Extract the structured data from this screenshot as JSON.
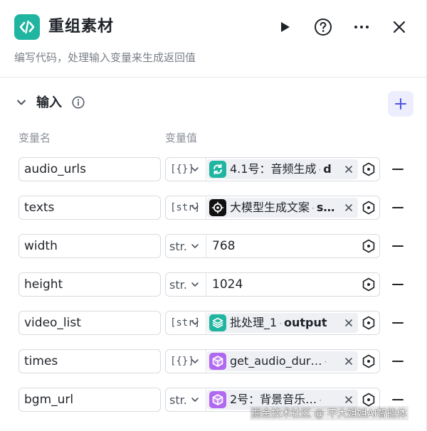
{
  "header": {
    "title": "重组素材",
    "subtitle": "编写代码，处理输入变量来生成返回值"
  },
  "input_section": {
    "title": "输入",
    "col_name": "变量名",
    "col_value": "变量值"
  },
  "rows": [
    {
      "name": "audio_urls",
      "type": "[{}]",
      "ref": {
        "node": "4.1号：音频生成",
        "output": "d"
      }
    },
    {
      "name": "texts",
      "type": "[str]",
      "ref": {
        "node": "大模型生成文案",
        "output": "s…"
      }
    },
    {
      "name": "width",
      "type": "str.",
      "value": "768"
    },
    {
      "name": "height",
      "type": "str.",
      "value": "1024"
    },
    {
      "name": "video_list",
      "type": "[str]",
      "ref": {
        "node": "批处理_1",
        "output": "output"
      }
    },
    {
      "name": "times",
      "type": "[{}]",
      "ref": {
        "node": "get_audio_dur…",
        "output": ""
      }
    },
    {
      "name": "bgm_url",
      "type": "str.",
      "ref": {
        "node": "2号：背景音乐…",
        "output": ""
      }
    }
  ],
  "watermark": "掘金技术社区 @ 不大姐姐AI智能体",
  "colors": {
    "accent": "#1fb5a0",
    "add_button_bg": "#eceefe",
    "add_icon": "#4d53e8"
  }
}
